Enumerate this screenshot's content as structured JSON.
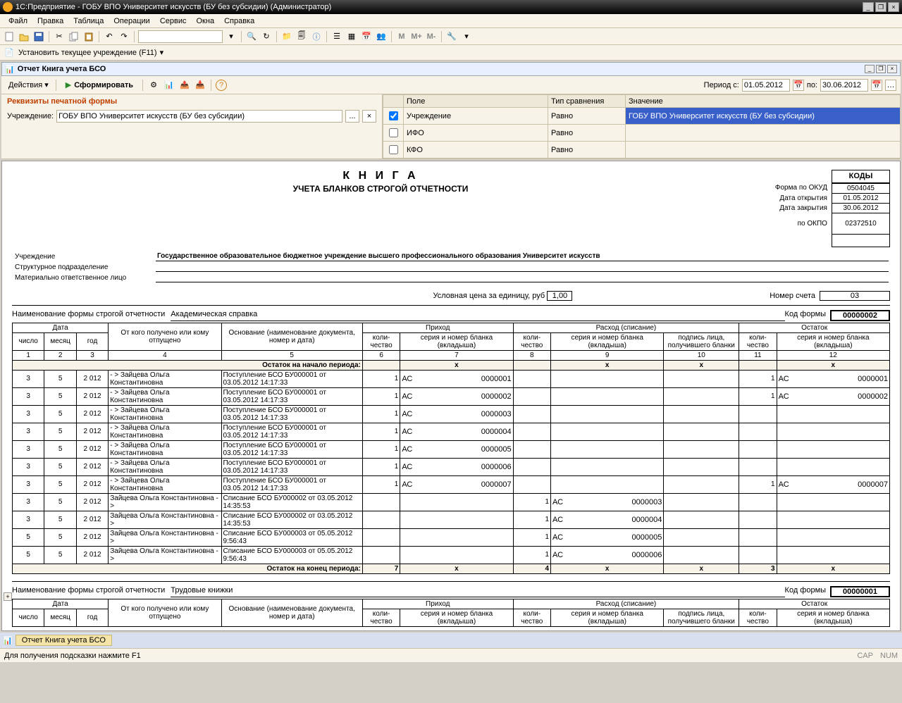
{
  "titlebar": {
    "text": "1С:Предприятие - ГОБУ ВПО Университет искусств (БУ без субсидии) (Администратор)"
  },
  "menu": [
    "Файл",
    "Правка",
    "Таблица",
    "Операции",
    "Сервис",
    "Окна",
    "Справка"
  ],
  "toolbar2": {
    "setOrg": "Установить текущее учреждение (F11)"
  },
  "subwin": {
    "title": "Отчет  Книга учета БСО"
  },
  "actions": {
    "label": "Действия",
    "form": "Сформировать"
  },
  "period": {
    "from_lbl": "Период с:",
    "from": "01.05.2012",
    "to_lbl": "по:",
    "to": "30.06.2012"
  },
  "req": {
    "title": "Реквизиты печатной формы",
    "org_lbl": "Учреждение:",
    "org_val": "ГОБУ ВПО Университет искусств (БУ без субсидии)"
  },
  "filter": {
    "hdr": [
      "",
      "Поле",
      "Тип сравнения",
      "Значение"
    ],
    "rows": [
      {
        "chk": true,
        "field": "Учреждение",
        "cmp": "Равно",
        "val": "ГОБУ ВПО Университет искусств (БУ без субсидии)",
        "sel": true
      },
      {
        "chk": false,
        "field": "ИФО",
        "cmp": "Равно",
        "val": ""
      },
      {
        "chk": false,
        "field": "КФО",
        "cmp": "Равно",
        "val": ""
      }
    ]
  },
  "report": {
    "title1": "К Н И Г А",
    "title2": "УЧЕТА БЛАНКОВ СТРОГОЙ ОТЧЕТНОСТИ",
    "codes_hdr": "КОДЫ",
    "okud_lbl": "Форма по ОКУД",
    "okud": "0504045",
    "open_lbl": "Дата открытия",
    "open": "01.05.2012",
    "close_lbl": "Дата закрытия",
    "close": "30.06.2012",
    "okpo_lbl": "по ОКПО",
    "okpo": "02372510",
    "org_lbl": "Учреждение",
    "org_val": "Государственное образовательное бюджетное учреждение высшего профессионального образования  Университет искусств",
    "dept_lbl": "Структурное подразделение",
    "resp_lbl": "Материально ответственное лицо",
    "price_lbl": "Условная цена за единицу, руб",
    "price": "1,00",
    "acct_lbl": "Номер счета",
    "acct": "03",
    "form_lbl": "Наименование формы строгой отчетности",
    "form_val1": "Академическая справка",
    "code_lbl": "Код формы",
    "code_val1": "00000002",
    "form_val2": "Трудовые книжки",
    "code_val2": "00000001",
    "hdr": {
      "date": "Дата",
      "day": "число",
      "month": "месяц",
      "year": "год",
      "from": "От кого получено или кому отпущено",
      "basis": "Основание (наименование документа, номер и дата)",
      "in": "Приход",
      "out": "Расход (списание)",
      "rest": "Остаток",
      "qty": "коли-чество",
      "serial": "серия и номер бланка (вкладыша)",
      "sign": "подпись лица, получившего бланки",
      "nums": [
        "1",
        "2",
        "3",
        "4",
        "5",
        "6",
        "7",
        "8",
        "9",
        "10",
        "11",
        "12"
      ]
    },
    "period_start": "Остаток на начало периода:",
    "period_end": "Остаток на конец периода:",
    "rows": [
      {
        "d": "3",
        "m": "5",
        "y": "2 012",
        "from": "- > Зайцева Ольга Константиновна",
        "basis": "Поступление БСО БУ000001 от 03.05.2012 14:17:33",
        "inq": "1",
        "ins": "АС",
        "inn": "0000001",
        "outq": "",
        "outs": "",
        "outn": "",
        "sign": "",
        "rq": "1",
        "rs": "АС",
        "rn": "0000001"
      },
      {
        "d": "3",
        "m": "5",
        "y": "2 012",
        "from": "- > Зайцева Ольга Константиновна",
        "basis": "Поступление БСО БУ000001 от 03.05.2012 14:17:33",
        "inq": "1",
        "ins": "АС",
        "inn": "0000002",
        "outq": "",
        "outs": "",
        "outn": "",
        "sign": "",
        "rq": "1",
        "rs": "АС",
        "rn": "0000002"
      },
      {
        "d": "3",
        "m": "5",
        "y": "2 012",
        "from": "- > Зайцева Ольга Константиновна",
        "basis": "Поступление БСО БУ000001 от 03.05.2012 14:17:33",
        "inq": "1",
        "ins": "АС",
        "inn": "0000003",
        "outq": "",
        "outs": "",
        "outn": "",
        "sign": "",
        "rq": "",
        "rs": "",
        "rn": ""
      },
      {
        "d": "3",
        "m": "5",
        "y": "2 012",
        "from": "- > Зайцева Ольга Константиновна",
        "basis": "Поступление БСО БУ000001 от 03.05.2012 14:17:33",
        "inq": "1",
        "ins": "АС",
        "inn": "0000004",
        "outq": "",
        "outs": "",
        "outn": "",
        "sign": "",
        "rq": "",
        "rs": "",
        "rn": ""
      },
      {
        "d": "3",
        "m": "5",
        "y": "2 012",
        "from": "- > Зайцева Ольга Константиновна",
        "basis": "Поступление БСО БУ000001 от 03.05.2012 14:17:33",
        "inq": "1",
        "ins": "АС",
        "inn": "0000005",
        "outq": "",
        "outs": "",
        "outn": "",
        "sign": "",
        "rq": "",
        "rs": "",
        "rn": ""
      },
      {
        "d": "3",
        "m": "5",
        "y": "2 012",
        "from": "- > Зайцева Ольга Константиновна",
        "basis": "Поступление БСО БУ000001 от 03.05.2012 14:17:33",
        "inq": "1",
        "ins": "АС",
        "inn": "0000006",
        "outq": "",
        "outs": "",
        "outn": "",
        "sign": "",
        "rq": "",
        "rs": "",
        "rn": ""
      },
      {
        "d": "3",
        "m": "5",
        "y": "2 012",
        "from": "- > Зайцева Ольга Константиновна",
        "basis": "Поступление БСО БУ000001 от 03.05.2012 14:17:33",
        "inq": "1",
        "ins": "АС",
        "inn": "0000007",
        "outq": "",
        "outs": "",
        "outn": "",
        "sign": "",
        "rq": "1",
        "rs": "АС",
        "rn": "0000007"
      },
      {
        "d": "3",
        "m": "5",
        "y": "2 012",
        "from": "Зайцева Ольга Константиновна - >",
        "basis": "Списание БСО БУ000002 от 03.05.2012 14:35:53",
        "inq": "",
        "ins": "",
        "inn": "",
        "outq": "1",
        "outs": "АС",
        "outn": "0000003",
        "sign": "",
        "rq": "",
        "rs": "",
        "rn": ""
      },
      {
        "d": "3",
        "m": "5",
        "y": "2 012",
        "from": "Зайцева Ольга Константиновна - >",
        "basis": "Списание БСО БУ000002 от 03.05.2012 14:35:53",
        "inq": "",
        "ins": "",
        "inn": "",
        "outq": "1",
        "outs": "АС",
        "outn": "0000004",
        "sign": "",
        "rq": "",
        "rs": "",
        "rn": ""
      },
      {
        "d": "5",
        "m": "5",
        "y": "2 012",
        "from": "Зайцева Ольга Константиновна - >",
        "basis": "Списание БСО БУ000003 от 05.05.2012 9:56:43",
        "inq": "",
        "ins": "",
        "inn": "",
        "outq": "1",
        "outs": "АС",
        "outn": "0000005",
        "sign": "",
        "rq": "",
        "rs": "",
        "rn": ""
      },
      {
        "d": "5",
        "m": "5",
        "y": "2 012",
        "from": "Зайцева Ольга Константиновна - >",
        "basis": "Списание БСО БУ000003 от 05.05.2012 9:56:43",
        "inq": "",
        "ins": "",
        "inn": "",
        "outq": "1",
        "outs": "АС",
        "outn": "0000006",
        "sign": "",
        "rq": "",
        "rs": "",
        "rn": ""
      }
    ],
    "end": {
      "inq": "7",
      "outq": "4",
      "rq": "3"
    }
  },
  "taskbar": {
    "tab": "Отчет  Книга учета БСО"
  },
  "status": {
    "hint": "Для получения подсказки нажмите F1",
    "cap": "CAP",
    "num": "NUM"
  }
}
